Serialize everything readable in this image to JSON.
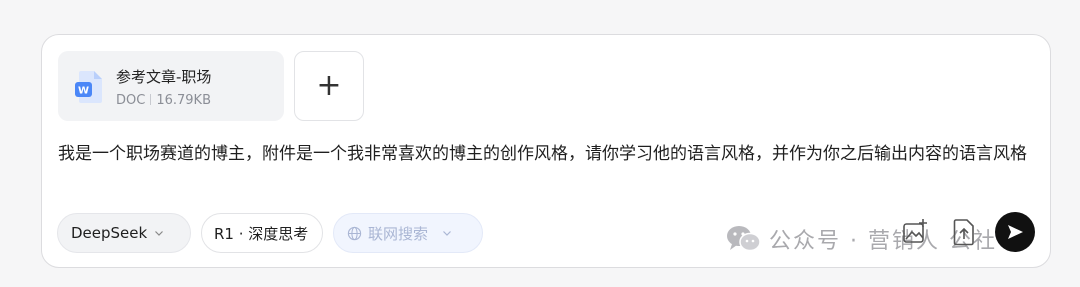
{
  "attachment": {
    "name": "参考文章-职场",
    "type": "DOC",
    "size": "16.79KB",
    "icon": "word-doc-icon"
  },
  "add_button": {
    "label": "+"
  },
  "prompt": {
    "text": "我是一个职场赛道的博主，附件是一个我非常喜欢的博主的创作风格，请你学习他的语言风格，并作为你之后输出内容的语言风格"
  },
  "toolbar": {
    "model": "DeepSeek",
    "reasoning": "R1 · 深度思考",
    "web_search": "联网搜索"
  },
  "watermark": {
    "text": "公众号 · 营销人 公社"
  },
  "colors": {
    "accent": "#111111",
    "doc_blue": "#4b87f7",
    "search_text": "#aab6d4"
  }
}
